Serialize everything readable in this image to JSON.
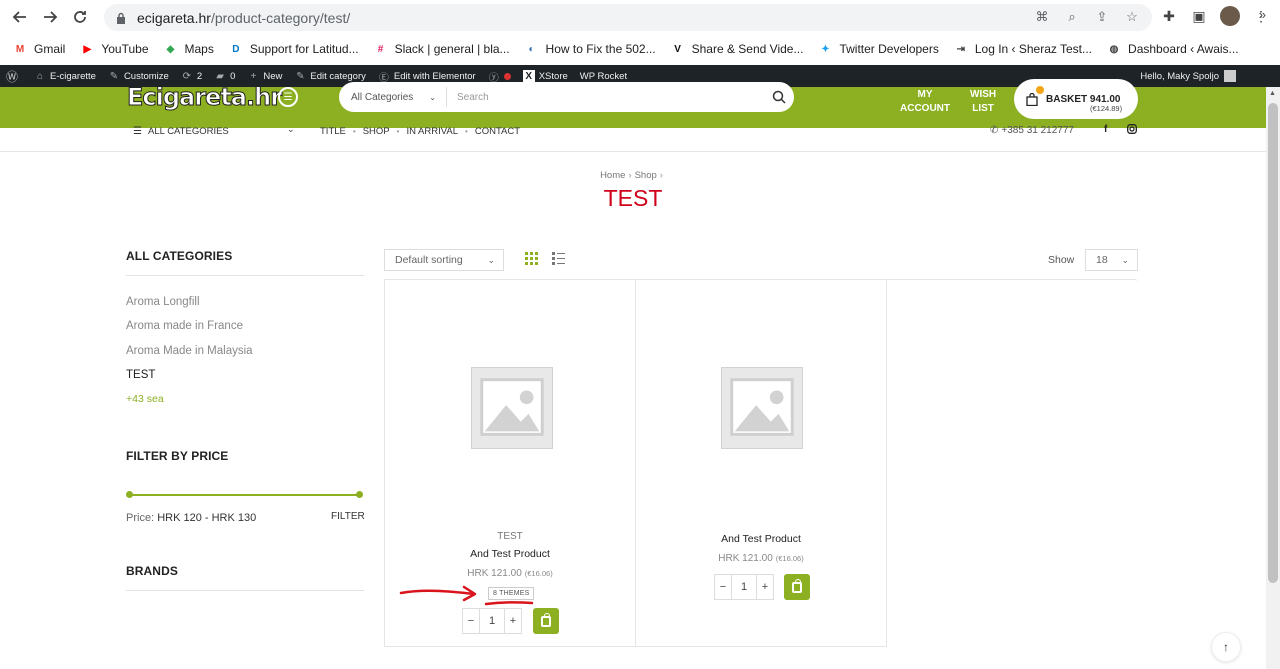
{
  "browser": {
    "url_host": "ecigareta.hr",
    "url_path": "/product-category/test/",
    "bookmarks": [
      {
        "label": "Gmail",
        "icon": "gmail-icon",
        "color": "#ea4335",
        "glyph": "M"
      },
      {
        "label": "YouTube",
        "icon": "youtube-icon",
        "color": "#ff0000",
        "glyph": "▶"
      },
      {
        "label": "Maps",
        "icon": "maps-icon",
        "color": "#34a853",
        "glyph": "◆"
      },
      {
        "label": "Support for Latitud...",
        "icon": "dell-icon",
        "color": "#0076ce",
        "glyph": "D"
      },
      {
        "label": "Slack | general | bla...",
        "icon": "slack-icon",
        "color": "#e01e5a",
        "glyph": "#"
      },
      {
        "label": "How to Fix the 502...",
        "icon": "kinsta-icon",
        "color": "#2b6cb0",
        "glyph": "◐"
      },
      {
        "label": "Share & Send Vide...",
        "icon": "vimeo-icon",
        "color": "#111111",
        "glyph": "V"
      },
      {
        "label": "Twitter Developers",
        "icon": "twitter-icon",
        "color": "#1da1f2",
        "glyph": "✦"
      },
      {
        "label": "Log In ‹ Sheraz Test...",
        "icon": "login-icon",
        "color": "#444444",
        "glyph": "⇥"
      },
      {
        "label": "Dashboard ‹ Awais...",
        "icon": "globe-icon",
        "color": "#444444",
        "glyph": "◍"
      }
    ]
  },
  "wpbar": {
    "site": "E-cigarette",
    "customize": "Customize",
    "updates": "2",
    "comments": "0",
    "new": "New",
    "edit_category": "Edit category",
    "edit_elementor": "Edit with Elementor",
    "xstore": "XStore",
    "wp_rocket": "WP Rocket",
    "greeting": "Hello, Maky Spoljo"
  },
  "header": {
    "logo": "Ecigareta.hr",
    "search_category": "All Categories",
    "search_placeholder": "Search",
    "my_account_line1": "MY",
    "my_account_line2": "ACCOUNT",
    "wishlist_line1": "WISH",
    "wishlist_line2": "LIST",
    "basket_label": "BASKET",
    "basket_total": "941.00",
    "basket_sub": "(€124.89)",
    "all_categories": "ALL CATEGORIES",
    "nav": [
      "TITLE",
      "SHOP",
      "IN ARRIVAL",
      "CONTACT"
    ],
    "phone": "+385 31 212777"
  },
  "breadcrumb": {
    "home": "Home",
    "shop": "Shop"
  },
  "page_title": "TEST",
  "sidebar": {
    "categories_heading": "ALL CATEGORIES",
    "categories": [
      {
        "label": "Aroma Longfill",
        "active": false
      },
      {
        "label": "Aroma made in France",
        "active": false
      },
      {
        "label": "Aroma Made in Malaysia",
        "active": false
      },
      {
        "label": "TEST",
        "active": true
      }
    ],
    "more": "+43 sea",
    "price_heading": "FILTER BY PRICE",
    "price_prefix": "Price:",
    "price_range": "HRK 120 - HRK 130",
    "filter_button": "FILTER",
    "brands_heading": "BRANDS"
  },
  "toolbar": {
    "sorting": "Default sorting",
    "show_label": "Show",
    "show_value": "18"
  },
  "products": [
    {
      "category": "TEST",
      "name": "And Test Product",
      "price": "HRK 121.00",
      "price_eur": "(€16.06)",
      "badge": "8 THEMES",
      "qty": "1"
    },
    {
      "category": "",
      "name": "And Test Product",
      "price": "HRK 121.00",
      "price_eur": "(€16.06)",
      "badge": "",
      "qty": "1"
    }
  ],
  "colors": {
    "brand_green": "#8cb022",
    "title_red": "#d0021b",
    "annotation_red": "#d9141b",
    "wpbar_bg": "#1d2327"
  }
}
